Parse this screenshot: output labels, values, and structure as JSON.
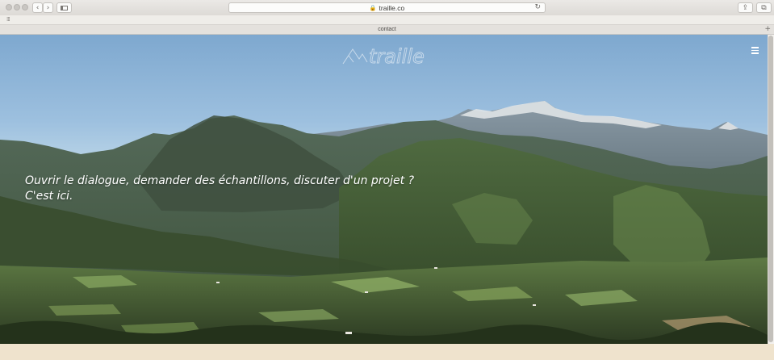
{
  "browser": {
    "url": "traille.co",
    "tab_title": "contact",
    "back_icon": "chevron-left-icon",
    "forward_icon": "chevron-right-icon",
    "sidebar_icon": "sidebar-icon",
    "lock_icon": "lock-icon",
    "reload_icon": "reload-icon",
    "share_icon": "share-icon",
    "tabs_icon": "tabs-icon",
    "new_tab_icon": "plus-icon",
    "favorites_icon": "grid-icon"
  },
  "site": {
    "logo_text": "traille",
    "menu_icon": "hamburger-icon",
    "tagline_line1": "Ouvrir le dialogue, demander des échantillons, discuter d'un projet ?",
    "tagline_line2": "C'est ici."
  },
  "colors": {
    "sky": "#9dc0df",
    "footer": "#efe3cd",
    "text": "#ffffff"
  }
}
